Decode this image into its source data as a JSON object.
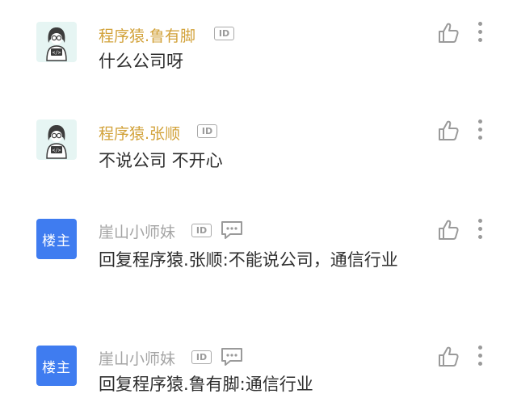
{
  "comments": [
    {
      "author": "程序猿.鲁有脚",
      "badge": "ID",
      "text": "什么公司呀",
      "avatar_icon": "coder-avatar"
    },
    {
      "author": "程序猿.张顺",
      "badge": "ID",
      "text": "不说公司 不开心",
      "avatar_icon": "coder-avatar"
    },
    {
      "author": "崖山小师妹",
      "badge": "ID",
      "op_label": "楼主",
      "text": "回复程序猿.张顺:不能说公司，通信行业",
      "avatar_icon": "op-avatar"
    },
    {
      "author": "崖山小师妹",
      "badge": "ID",
      "op_label": "楼主",
      "text": "回复程序猿.鲁有脚:通信行业",
      "avatar_icon": "op-avatar"
    }
  ],
  "colors": {
    "author_gold": "#d2a23a",
    "author_gray": "#a4a4a4",
    "op_avatar_bg": "#3f7cf0",
    "icon_gray": "#9a9a9a"
  }
}
